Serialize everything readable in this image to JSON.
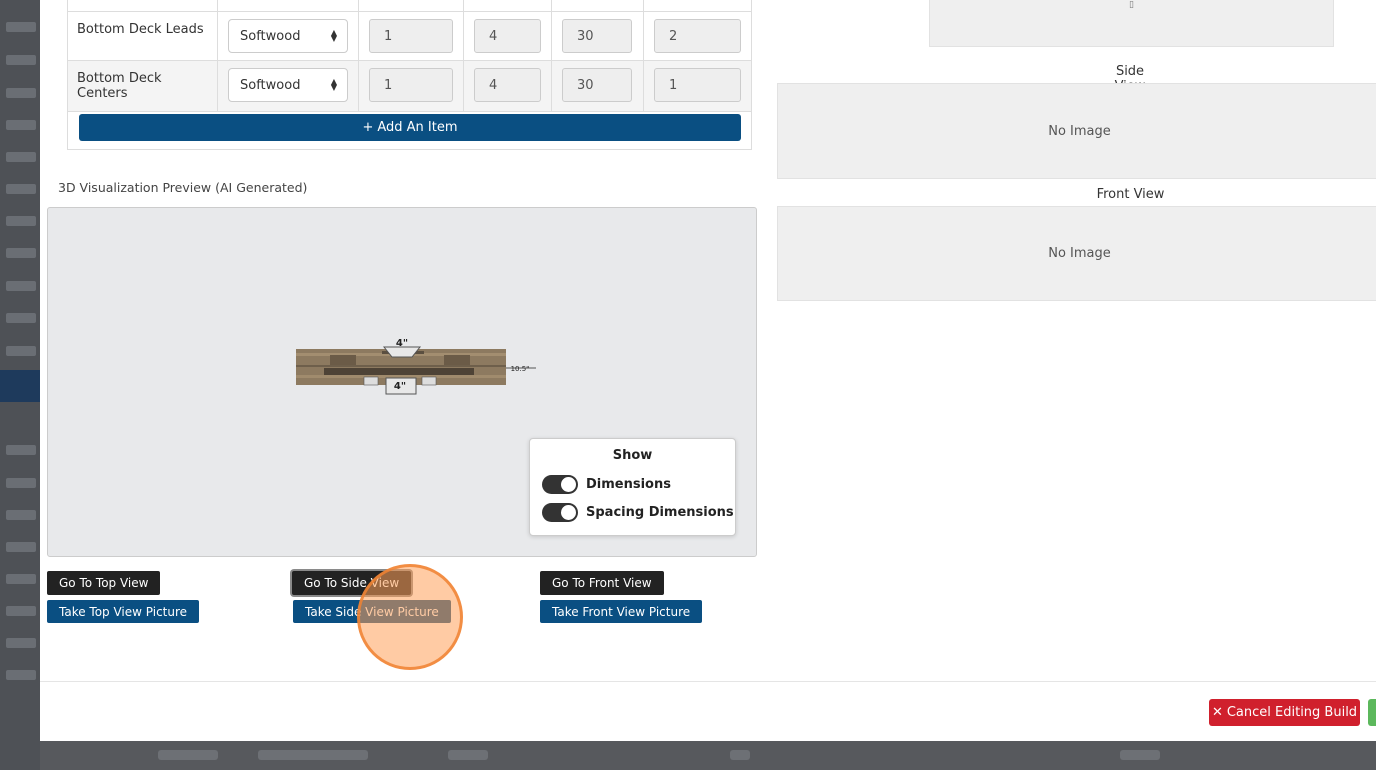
{
  "table": {
    "rows": [
      {
        "name": "Bottom Deck Leads",
        "type": "Softwood",
        "v1": "1",
        "v2": "4",
        "v3": "30",
        "v4": "2"
      },
      {
        "name": "Bottom Deck Centers",
        "type": "Softwood",
        "v1": "1",
        "v2": "4",
        "v3": "30",
        "v4": "1"
      }
    ],
    "add_label": "Add An Item"
  },
  "viz": {
    "title": "3D Visualization Preview (AI Generated)",
    "show_panel": {
      "title": "Show",
      "toggles": [
        {
          "label": "Dimensions",
          "on": true
        },
        {
          "label": "Spacing Dimensions",
          "on": true
        }
      ]
    },
    "model_labels": {
      "top": "4\"",
      "bottom": "4\"",
      "right": "10.5\""
    },
    "buttons": {
      "top_view": "Go To Top View",
      "side_view": "Go To Side View",
      "front_view": "Go To Front View",
      "take_top": "Take Top View Picture",
      "take_side": "Take Side View Picture",
      "take_front": "Take Front View Picture"
    }
  },
  "views": {
    "side_label": "Side View",
    "front_label": "Front View",
    "no_image": "No Image"
  },
  "footer": {
    "cancel_label": "Cancel Editing Build"
  },
  "colors": {
    "primary_blue": "#0a4f82",
    "danger_red": "#d0202d",
    "success_green": "#5cb85c"
  }
}
